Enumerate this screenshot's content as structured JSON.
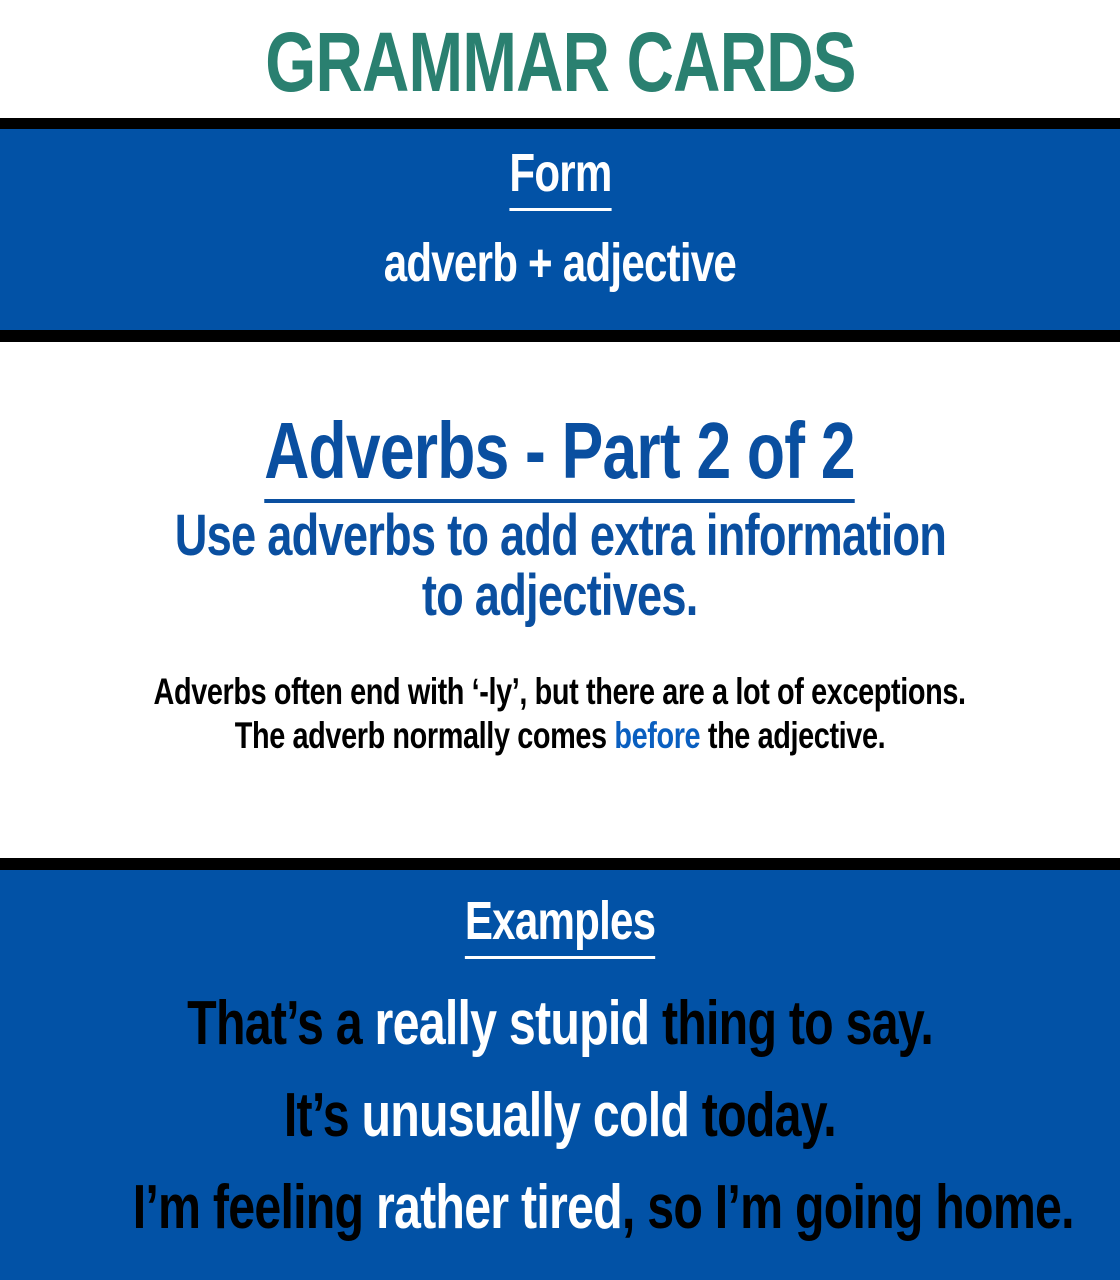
{
  "title": "GRAMMAR CARDS",
  "form": {
    "heading": "Form",
    "text": "adverb + adjective"
  },
  "lesson": {
    "heading": "Adverbs - Part 2 of 2",
    "subtitle_line1": "Use adverbs to add extra information",
    "subtitle_line2": "to adjectives.",
    "note_line1": "Adverbs often end with ‘-ly’, but there are a lot of exceptions.",
    "note_line2_a": "The adverb normally comes ",
    "note_line2_hl": "before",
    "note_line2_b": " the adjective."
  },
  "examples": {
    "heading": "Examples",
    "items": [
      {
        "a": "That’s a ",
        "hl": "really stupid",
        "b": " thing to say."
      },
      {
        "a": "It’s ",
        "hl": "unusually cold",
        "b": " today."
      },
      {
        "a": "I’m feeling ",
        "hl": "rather tired",
        "b": ", so I’m going home."
      }
    ]
  },
  "colors": {
    "title": "#2a8070",
    "panel": "#0252a6",
    "heading": "#0a4fa0",
    "highlight": "#0a5fc0"
  }
}
